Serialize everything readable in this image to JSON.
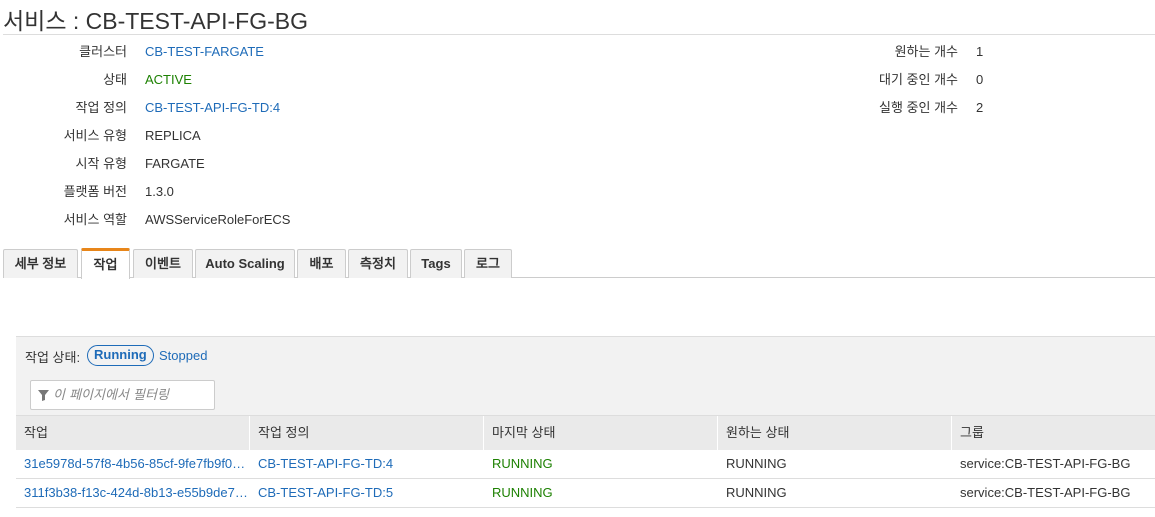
{
  "header": {
    "title": "서비스 : CB-TEST-API-FG-BG"
  },
  "details": [
    {
      "label": "클러스터",
      "value": "CB-TEST-FARGATE",
      "style": "link"
    },
    {
      "label": "상태",
      "value": "ACTIVE",
      "style": "green"
    },
    {
      "label": "작업 정의",
      "value": "CB-TEST-API-FG-TD:4",
      "style": "link"
    },
    {
      "label": "서비스 유형",
      "value": "REPLICA",
      "style": "plain"
    },
    {
      "label": "시작 유형",
      "value": "FARGATE",
      "style": "plain"
    },
    {
      "label": "플랫폼 버전",
      "value": "1.3.0",
      "style": "plain"
    },
    {
      "label": "서비스 역할",
      "value": "AWSServiceRoleForECS",
      "style": "plain"
    }
  ],
  "counts": [
    {
      "label": "원하는 개수",
      "value": "1"
    },
    {
      "label": "대기 중인 개수",
      "value": "0"
    },
    {
      "label": "실행 중인 개수",
      "value": "2"
    }
  ],
  "tabs": [
    "세부 정보",
    "작업",
    "이벤트",
    "Auto Scaling",
    "배포",
    "측정치",
    "Tags",
    "로그"
  ],
  "active_tab": "작업",
  "tasks": {
    "status_label": "작업 상태:",
    "running_label": "Running",
    "stopped_label": "Stopped",
    "filter_placeholder": "이 페이지에서 필터링",
    "columns": [
      "작업",
      "작업 정의",
      "마지막 상태",
      "원하는 상태",
      "그룹"
    ],
    "rows": [
      [
        "31e5978d-57f8-4b56-85cf-9fe7fb9f0…",
        "CB-TEST-API-FG-TD:4",
        "RUNNING",
        "RUNNING",
        "service:CB-TEST-API-FG-BG"
      ],
      [
        "311f3b38-f13c-424d-8b13-e55b9de7…",
        "CB-TEST-API-FG-TD:5",
        "RUNNING",
        "RUNNING",
        "service:CB-TEST-API-FG-BG"
      ]
    ]
  },
  "colors": {
    "link": "#1e6bb8",
    "running": "#1d8102",
    "tab_accent": "#e8861a"
  },
  "icons": {
    "filter": "filter-funnel-icon"
  }
}
